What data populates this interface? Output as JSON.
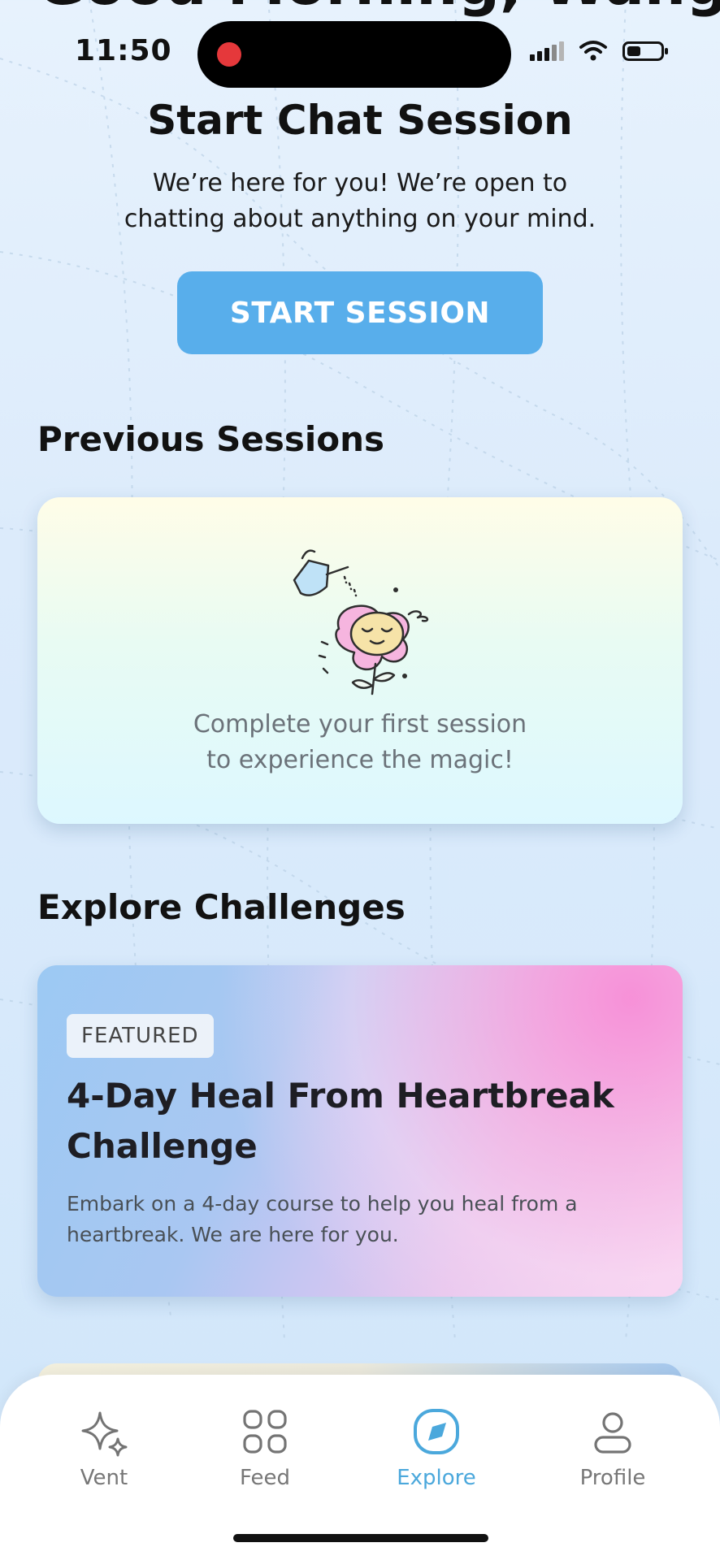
{
  "status_bar": {
    "time": "11:50"
  },
  "greeting": "Good Morning, Wang!",
  "chat_session": {
    "title": "Start Chat Session",
    "description_line1": "We’re here for you! We’re open to",
    "description_line2": "chatting about anything on your mind.",
    "button_label": "START SESSION"
  },
  "previous_sessions": {
    "heading": "Previous Sessions",
    "empty_line1": "Complete your first session",
    "empty_line2": "to experience the magic!"
  },
  "explore_challenges": {
    "heading": "Explore Challenges",
    "featured_badge": "FEATURED",
    "title": "4-Day Heal From Heartbreak Challenge",
    "description": "Embark on a 4-day course to help you heal from a heartbreak. We are here for you."
  },
  "bottom_nav": {
    "items": [
      {
        "label": "Vent",
        "icon": "sparkle-icon",
        "active": false
      },
      {
        "label": "Feed",
        "icon": "grid-icon",
        "active": false
      },
      {
        "label": "Explore",
        "icon": "compass-icon",
        "active": true
      },
      {
        "label": "Profile",
        "icon": "user-icon",
        "active": false
      }
    ]
  },
  "colors": {
    "accent": "#58aeeb",
    "active_nav": "#4ba8dc",
    "recording": "#e5383b"
  }
}
